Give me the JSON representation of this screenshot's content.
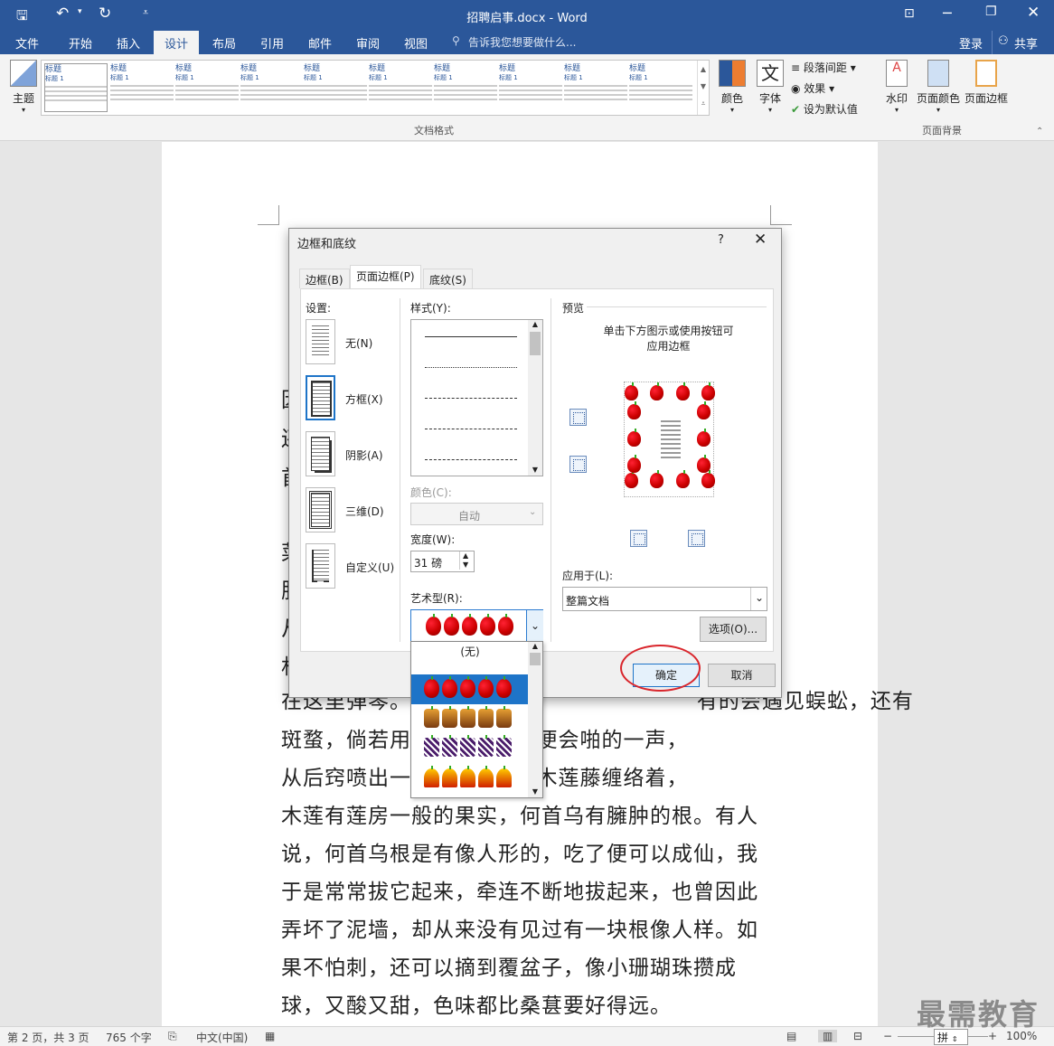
{
  "window": {
    "title": "招聘启事.docx - Word"
  },
  "ribbon_tabs": [
    "文件",
    "开始",
    "插入",
    "设计",
    "布局",
    "引用",
    "邮件",
    "审阅",
    "视图"
  ],
  "active_tab": "设计",
  "tell_me": "告诉我您想要做什么...",
  "account": {
    "signin": "登录",
    "share": "共享"
  },
  "ribbon": {
    "theme_label": "主题",
    "gallery_group": "文档格式",
    "gallery_items": [
      {
        "title": "标题",
        "sub": "标题 1"
      },
      {
        "title": "标题",
        "sub": "标题 1"
      },
      {
        "title": "标题",
        "sub": "标题 1"
      },
      {
        "title": "标题",
        "sub": "标题 1"
      },
      {
        "title": "标题",
        "sub": "标题 1"
      },
      {
        "title": "标题",
        "sub": "标题 1"
      },
      {
        "title": "标题",
        "sub": "标题 1"
      },
      {
        "title": "标题",
        "sub": "标题 1"
      },
      {
        "title": "标题",
        "sub": "标题 1"
      },
      {
        "title": "标题",
        "sub": "标题 1"
      }
    ],
    "colors_label": "颜色",
    "fonts_label": "字体",
    "fonts_icon_text": "文",
    "para_spacing": "段落间距",
    "effects": "效果",
    "set_default": "设为默认值",
    "watermark": "水印",
    "page_color": "页面颜色",
    "page_borders": "页面边框",
    "bg_group": "页面背景"
  },
  "document_lines": [
    "在这里弹琴。                                      有的会遇见蜈蚣，还有",
    "斑蝥，倘若用        背梁，便会啪的一声，",
    "从后窍喷出一        乌藤和木莲藤缠络着，",
    "木莲有莲房一般的果实，何首乌有臃肿的根。有人",
    "说，何首乌根是有像人形的，吃了便可以成仙，我",
    "于是常常拔它起来，牵连不断地拔起来，也曾因此",
    "弄坏了泥墙，却从来没有见过有一块根像人样。如",
    "果不怕刺，还可以摘到覆盆子，像小珊瑚珠攒成",
    "球，又酸又甜，色味都比桑葚要好得远。"
  ],
  "doc_edge_chars": [
    "因",
    "还",
    "首",
    "菜",
    "肥",
    "从",
    "村"
  ],
  "dialog": {
    "title": "边框和底纹",
    "help": "?",
    "tabs": [
      "边框(B)",
      "页面边框(P)",
      "底纹(S)"
    ],
    "active_tab": "页面边框(P)",
    "setting_label": "设置:",
    "settings": [
      "无(N)",
      "方框(X)",
      "阴影(A)",
      "三维(D)",
      "自定义(U)"
    ],
    "selected_setting": "方框(X)",
    "style_label": "样式(Y):",
    "color_label": "颜色(C):",
    "color_value": "自动",
    "width_label": "宽度(W):",
    "width_value": "31 磅",
    "art_label": "艺术型(R):",
    "art_none": "(无)",
    "preview_label": "预览",
    "preview_hint_1": "单击下方图示或使用按钮可",
    "preview_hint_2": "应用边框",
    "apply_label": "应用于(L):",
    "apply_value": "整篇文档",
    "options_button": "选项(O)...",
    "ok_button": "确定",
    "cancel_button": "取消"
  },
  "status": {
    "page": "第 2 页，共 3 页",
    "words": "765 个字",
    "lang": "中文(中国)",
    "zoom": "100%",
    "ime": "拼"
  },
  "watermark_text": "最需教育",
  "colors": {
    "accent": "#2b579a",
    "highlight": "#d9262c",
    "selection": "#1e74c8"
  }
}
